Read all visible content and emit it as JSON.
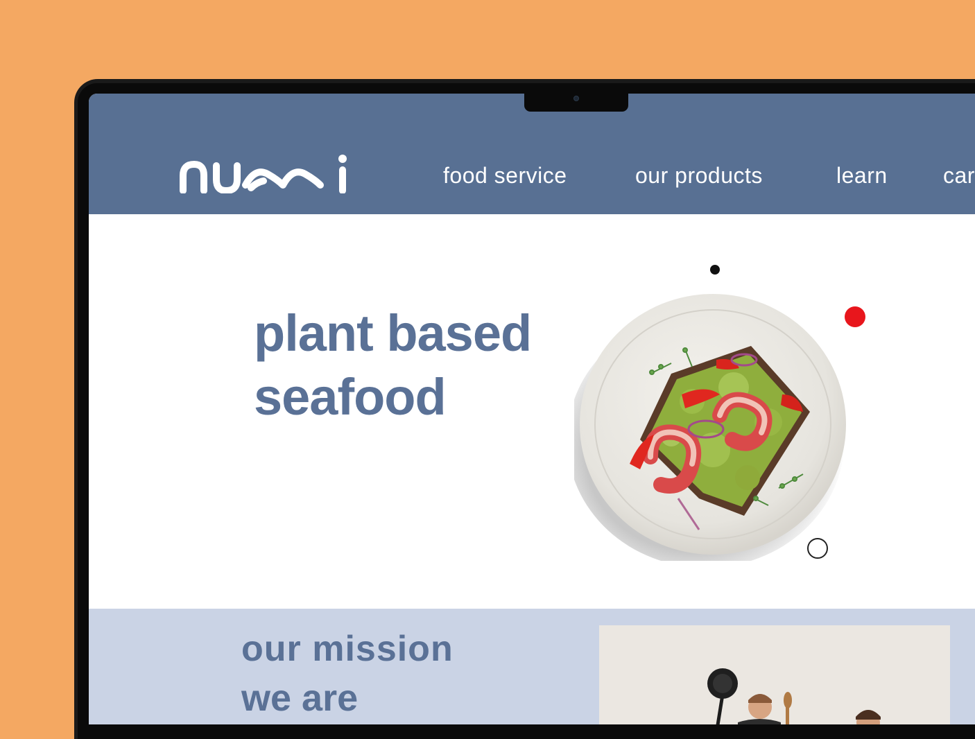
{
  "brand": {
    "logo_text": "numi",
    "background_color": "#F4A862",
    "nav_color": "#587093",
    "accent_text_color": "#5A7196",
    "mission_bg_color": "#CAD3E5",
    "dot_red_color": "#E8161C"
  },
  "nav": {
    "items": [
      {
        "label": "food service"
      },
      {
        "label": "our products"
      },
      {
        "label": "learn"
      },
      {
        "label": "car"
      }
    ]
  },
  "hero": {
    "title_line1": "plant based",
    "title_line2": "seafood",
    "image": "plant-based-shrimp-avocado-toast-plate"
  },
  "mission": {
    "subtitle": "our mission",
    "heading": "we are",
    "image": "team-photo"
  }
}
